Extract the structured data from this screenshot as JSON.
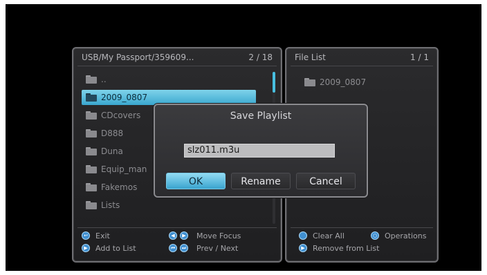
{
  "left_panel": {
    "path": "USB/My Passport/359609...",
    "count": "2 / 18",
    "items": [
      {
        "label": ".."
      },
      {
        "label": "2009_0807"
      },
      {
        "label": "CDcovers"
      },
      {
        "label": "D888"
      },
      {
        "label": "Duna"
      },
      {
        "label": "Equip_man"
      },
      {
        "label": "Fakemos"
      },
      {
        "label": "Lists"
      }
    ],
    "hints": {
      "exit": "Exit",
      "add_to_list": "Add to List",
      "move_focus": "Move Focus",
      "prev_next": "Prev / Next"
    }
  },
  "right_panel": {
    "title": "File List",
    "count": "1 / 1",
    "items": [
      {
        "label": "2009_0807"
      }
    ],
    "hints": {
      "clear_all": "Clear All",
      "operations": "Operations",
      "remove_from_list": "Remove from List"
    }
  },
  "dialog": {
    "title": "Save Playlist",
    "input_value": "slz011.m3u",
    "ok_label": "OK",
    "rename_label": "Rename",
    "cancel_label": "Cancel"
  },
  "colors": {
    "accent": "#48bfe0",
    "background": "#000000",
    "panel": "#2b2b2d"
  }
}
